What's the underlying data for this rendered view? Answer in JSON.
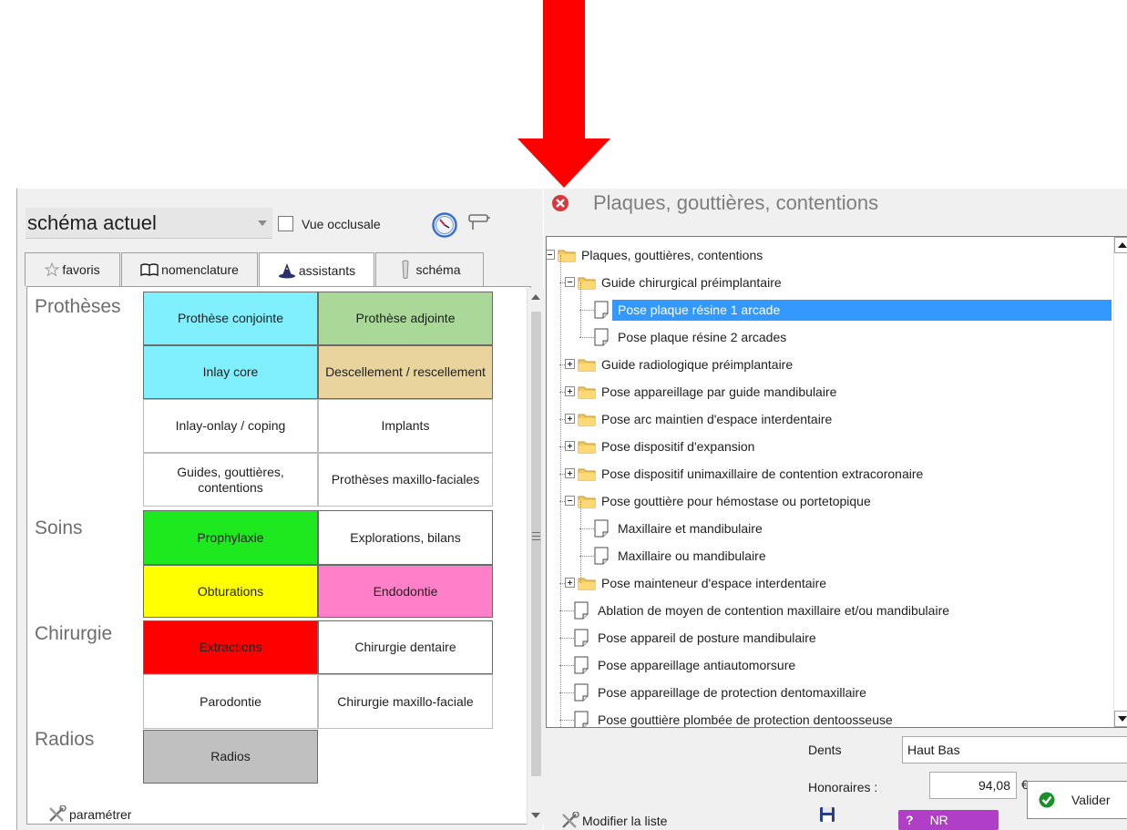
{
  "left": {
    "schema_select_value": "schéma actuel",
    "vue_occlusale_label": "Vue occlusale",
    "vue_occlusale_checked": false,
    "tabs": [
      {
        "label": "favoris",
        "icon": "star-icon"
      },
      {
        "label": "nomenclature",
        "icon": "book-icon"
      },
      {
        "label": "assistants",
        "icon": "wizard-hat-icon",
        "active": true
      },
      {
        "label": "schéma",
        "icon": "tooth-icon"
      }
    ],
    "sections": {
      "protheses": "Prothèses",
      "soins": "Soins",
      "chirurgie": "Chirurgie",
      "radios": "Radios"
    },
    "cells": {
      "prothese_conjointe": {
        "label": "Prothèse conjointe",
        "color": "#80f0ff"
      },
      "prothese_adjointe": {
        "label": "Prothèse adjointe",
        "color": "#aad898"
      },
      "inlay_core": {
        "label": "Inlay core",
        "color": "#80f0ff"
      },
      "descellement": {
        "label": "Descellement / rescellement",
        "color": "#e8d49c"
      },
      "inlay_onlay": {
        "label": "Inlay-onlay / coping",
        "color": "#ffffff"
      },
      "implants": {
        "label": "Implants",
        "color": "#ffffff"
      },
      "guides": {
        "label": "Guides, gouttières, contentions",
        "color": "#ffffff"
      },
      "protheses_mf": {
        "label": "Prothèses maxillo-faciales",
        "color": "#ffffff"
      },
      "prophylaxie": {
        "label": "Prophylaxie",
        "color": "#1ee81e"
      },
      "explorations": {
        "label": "Explorations, bilans",
        "color": "#ffffff"
      },
      "obturations": {
        "label": "Obturations",
        "color": "#ffff00"
      },
      "endodontie": {
        "label": "Endodontie",
        "color": "#ff80c8"
      },
      "extractions": {
        "label": "Extractions",
        "color": "#ff0000"
      },
      "chirurgie_dentaire": {
        "label": "Chirurgie dentaire",
        "color": "#ffffff"
      },
      "parodontie": {
        "label": "Parodontie",
        "color": "#ffffff"
      },
      "chirurgie_mf": {
        "label": "Chirurgie maxillo-faciale",
        "color": "#ffffff"
      },
      "radios": {
        "label": "Radios",
        "color": "#c0c0c0"
      }
    },
    "parametrer_label": "paramétrer"
  },
  "right": {
    "title": "Plaques, gouttières, contentions",
    "tree": [
      {
        "label": "Plaques, gouttières, contentions",
        "level": 0,
        "type": "folder",
        "expanded": true
      },
      {
        "label": "Guide chirurgical préimplantaire",
        "level": 1,
        "type": "folder",
        "expanded": true
      },
      {
        "label": "Pose plaque résine 1 arcade",
        "level": 2,
        "type": "doc",
        "selected": true
      },
      {
        "label": "Pose plaque résine 2 arcades",
        "level": 2,
        "type": "doc"
      },
      {
        "label": "Guide radiologique préimplantaire",
        "level": 1,
        "type": "folder",
        "expanded": false
      },
      {
        "label": "Pose appareillage par guide mandibulaire",
        "level": 1,
        "type": "folder",
        "expanded": false
      },
      {
        "label": "Pose arc maintien d'espace interdentaire",
        "level": 1,
        "type": "folder",
        "expanded": false
      },
      {
        "label": "Pose dispositif d'expansion",
        "level": 1,
        "type": "folder",
        "expanded": false
      },
      {
        "label": "Pose dispositif unimaxillaire de contention extracoronaire",
        "level": 1,
        "type": "folder",
        "expanded": false
      },
      {
        "label": "Pose gouttière pour hémostase ou portetopique",
        "level": 1,
        "type": "folder",
        "expanded": true
      },
      {
        "label": "Maxillaire et mandibulaire",
        "level": 2,
        "type": "doc"
      },
      {
        "label": "Maxillaire ou mandibulaire",
        "level": 2,
        "type": "doc"
      },
      {
        "label": "Pose mainteneur d'espace interdentaire",
        "level": 1,
        "type": "folder",
        "expanded": false
      },
      {
        "label": "Ablation de moyen de contention maxillaire et/ou mandibulaire",
        "level": 1,
        "type": "doc"
      },
      {
        "label": "Pose appareil de posture mandibulaire",
        "level": 1,
        "type": "doc"
      },
      {
        "label": "Pose appareillage antiautomorsure",
        "level": 1,
        "type": "doc"
      },
      {
        "label": "Pose appareillage de protection dentomaxillaire",
        "level": 1,
        "type": "doc"
      },
      {
        "label": "Pose gouttière plombée de protection dentoosseuse",
        "level": 1,
        "type": "doc"
      }
    ],
    "dents_label": "Dents",
    "dents_value": "Haut Bas",
    "honoraires_label": "Honoraires :",
    "honoraires_value": "94,08",
    "currency": "€",
    "nr_label": "NR",
    "nr_q": "?",
    "valider_label": "Valider",
    "modifier_label": "Modifier la liste",
    "colors": {
      "selection": "#3399ff",
      "nr_badge": "#b03ec6",
      "valider_check": "#1a8f2a",
      "close": "#d9363e",
      "arrow": "#ff0000"
    }
  }
}
